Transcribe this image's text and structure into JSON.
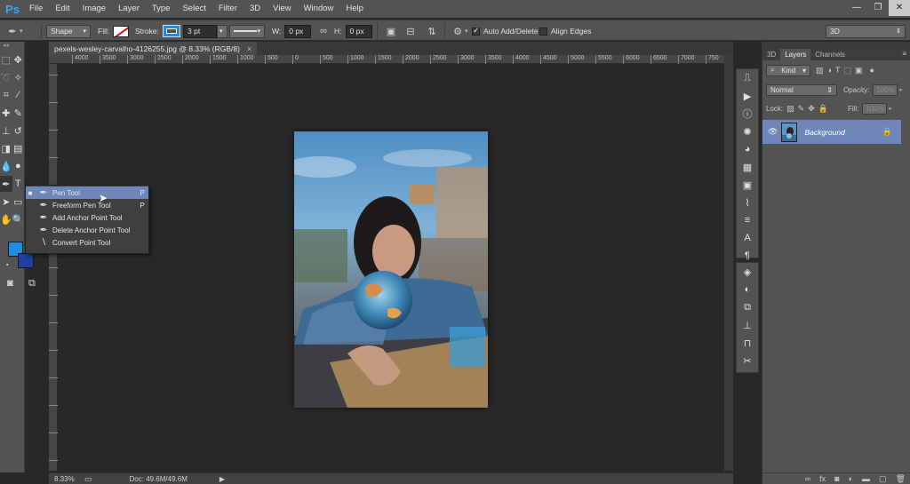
{
  "app": {
    "logo": "Ps"
  },
  "menu": [
    "File",
    "Edit",
    "Image",
    "Layer",
    "Type",
    "Select",
    "Filter",
    "3D",
    "View",
    "Window",
    "Help"
  ],
  "window_controls": {
    "minimize": "—",
    "restore": "❐",
    "close": "✕"
  },
  "options": {
    "mode_value": "Shape",
    "fill_label": "Fill:",
    "stroke_label": "Stroke:",
    "stroke_width": "3 pt",
    "w_label": "W:",
    "w_value": "0 px",
    "h_label": "H:",
    "h_value": "0 px",
    "auto_add_delete_label": "Auto Add/Delete",
    "auto_add_delete_checked": true,
    "align_edges_label": "Align Edges",
    "align_edges_checked": false,
    "workspace_value": "3D"
  },
  "document": {
    "tab_title": "pexels-wesley-carvalho-4126255.jpg @ 8.33% (RGB/8)",
    "tab_close": "×"
  },
  "ruler_labels": [
    "4000",
    "3500",
    "3000",
    "2500",
    "2000",
    "1500",
    "1000",
    "500",
    "0",
    "500",
    "1000",
    "1500",
    "2000",
    "2500",
    "3000",
    "3500",
    "4000",
    "4500",
    "5000",
    "5500",
    "6000",
    "6500",
    "7000",
    "750"
  ],
  "status": {
    "zoom": "8.33%",
    "doc": "Doc: 49.6M/49.6M",
    "arrow": "▶"
  },
  "flyout": [
    {
      "label": "Pen Tool",
      "key": "P",
      "active": true,
      "icon": "pen-icon"
    },
    {
      "label": "Freeform Pen Tool",
      "key": "P",
      "active": false,
      "icon": "freeform-pen-icon"
    },
    {
      "label": "Add Anchor Point Tool",
      "key": "",
      "active": false,
      "icon": "add-anchor-icon"
    },
    {
      "label": "Delete Anchor Point Tool",
      "key": "",
      "active": false,
      "icon": "delete-anchor-icon"
    },
    {
      "label": "Convert Point Tool",
      "key": "",
      "active": false,
      "icon": "convert-point-icon"
    }
  ],
  "colors": {
    "foreground": "#1f8ce0",
    "background": "#1c41a0",
    "selection": "#6e87b8"
  },
  "panels": {
    "tabs": [
      "3D",
      "Layers",
      "Channels"
    ],
    "active_tab": "Layers",
    "kind_label": "Kind",
    "blend_mode": "Normal",
    "opacity_label": "Opacity:",
    "opacity_value": "100%",
    "lock_label": "Lock:",
    "fill_label": "Fill:",
    "fill_value": "100%",
    "layer_name": "Background"
  }
}
